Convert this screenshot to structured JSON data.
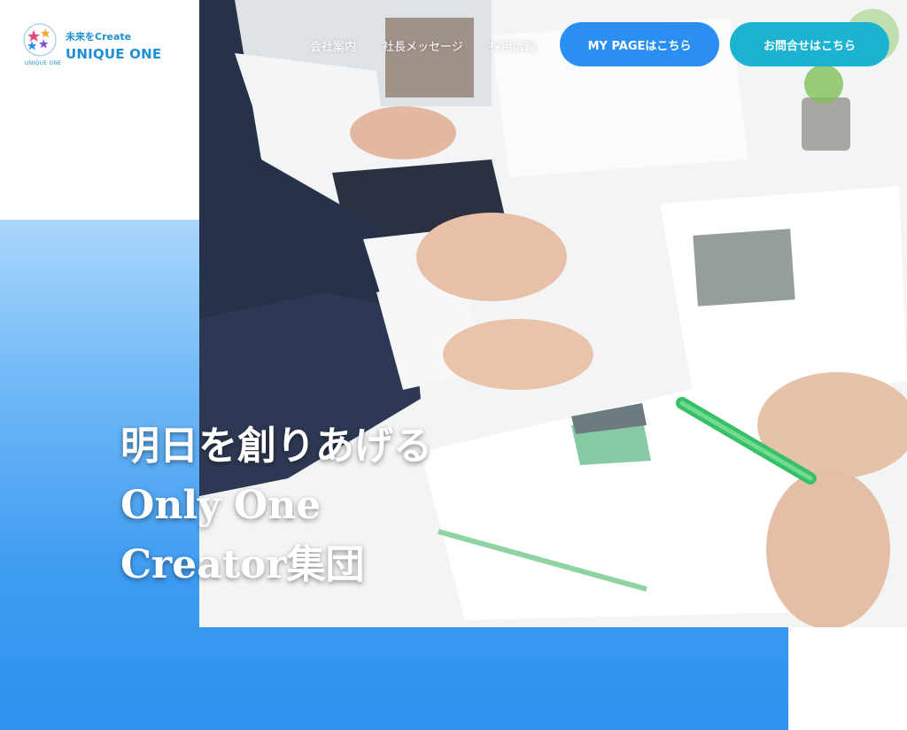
{
  "brand": {
    "tagline": "未来をCreate",
    "name": "UNIQUE ONE",
    "mark_caption": "UNIQUE ONE",
    "accent_color": "#1e8fd5"
  },
  "nav": {
    "items": [
      {
        "label": "会社案内"
      },
      {
        "label": "社長メッセージ"
      },
      {
        "label": "採用情報"
      }
    ],
    "mypage_button": "MY PAGEはこちら",
    "contact_button": "お問合せはこちら"
  },
  "hero": {
    "line1": "明日を創りあげる",
    "line2": "Only One",
    "line3": "Creator集団",
    "image": "business-meeting-photo"
  },
  "colors": {
    "mypage_button": "#2a8ff0",
    "contact_button": "#1bb3d1",
    "panel_gradient_top": "#a9d6fb",
    "panel_gradient_bottom": "#2f92ef"
  }
}
